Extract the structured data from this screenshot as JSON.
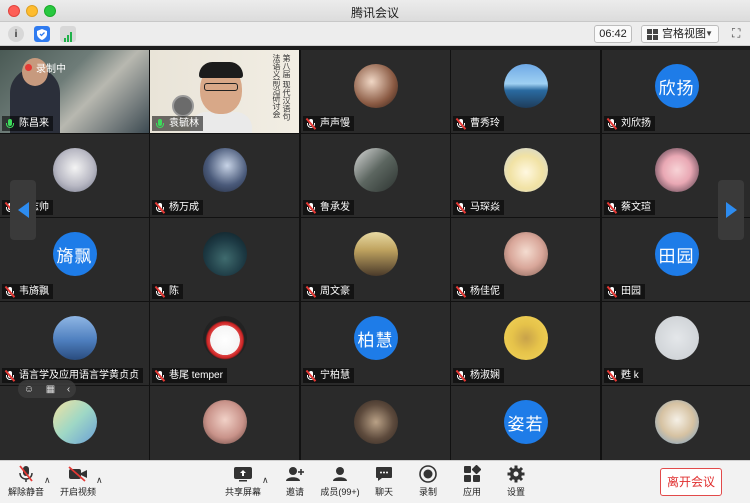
{
  "window": {
    "title": "腾讯会议"
  },
  "topbar": {
    "timer": "06:42",
    "view_label": "宫格视图"
  },
  "participants": [
    {
      "name": "陈昌来",
      "avatar": "",
      "mic": "on",
      "recording_label": "录制中"
    },
    {
      "name": "袁毓林",
      "avatar": "",
      "mic": "on",
      "poster_text": "第八届 现代汉语句法语义前沿研讨会"
    },
    {
      "name": "声声慢",
      "avatar": "",
      "mic": "muted"
    },
    {
      "name": "曹秀玲",
      "avatar": "",
      "mic": "muted"
    },
    {
      "name": "刘欣扬",
      "avatar": "欣扬",
      "mic": "muted"
    },
    {
      "name": "王志帅",
      "avatar": "",
      "mic": "muted"
    },
    {
      "name": "杨万成",
      "avatar": "",
      "mic": "muted"
    },
    {
      "name": "鲁承发",
      "avatar": "",
      "mic": "muted"
    },
    {
      "name": "马琛焱",
      "avatar": "",
      "mic": "muted"
    },
    {
      "name": "蔡文瑄",
      "avatar": "",
      "mic": "muted"
    },
    {
      "name": "韦旖飘",
      "avatar": "旖飘",
      "mic": "muted"
    },
    {
      "name": "陈",
      "avatar": "",
      "mic": "muted"
    },
    {
      "name": "周文豪",
      "avatar": "",
      "mic": "muted"
    },
    {
      "name": "杨佳伲",
      "avatar": "",
      "mic": "muted"
    },
    {
      "name": "田园",
      "avatar": "田园",
      "mic": "muted"
    },
    {
      "name": "语言学及应用语言学黄贞贞",
      "avatar": "",
      "mic": "muted"
    },
    {
      "name": "巷尾 temper",
      "avatar": "",
      "mic": "muted"
    },
    {
      "name": "宁柏慧",
      "avatar": "柏慧",
      "mic": "muted"
    },
    {
      "name": "杨淑娴",
      "avatar": "",
      "mic": "muted"
    },
    {
      "name": "甦 k",
      "avatar": "",
      "mic": "muted"
    },
    {
      "name": "",
      "avatar": "",
      "mic": "muted"
    },
    {
      "name": "",
      "avatar": "",
      "mic": "muted"
    },
    {
      "name": "",
      "avatar": "",
      "mic": "muted"
    },
    {
      "name": "",
      "avatar": "姿若",
      "mic": "muted"
    },
    {
      "name": "",
      "avatar": "",
      "mic": "muted"
    }
  ],
  "bottombar": {
    "unmute": "解除静音",
    "start_video": "开启视频",
    "share_screen": "共享屏幕",
    "invite": "邀请",
    "members": "成员(99+)",
    "chat": "聊天",
    "record": "录制",
    "apps": "应用",
    "settings": "设置",
    "leave": "离开会议"
  },
  "colors": {
    "accent": "#1e7ce8",
    "leave": "#e02f2f",
    "active_outline": "#2ecc71"
  }
}
